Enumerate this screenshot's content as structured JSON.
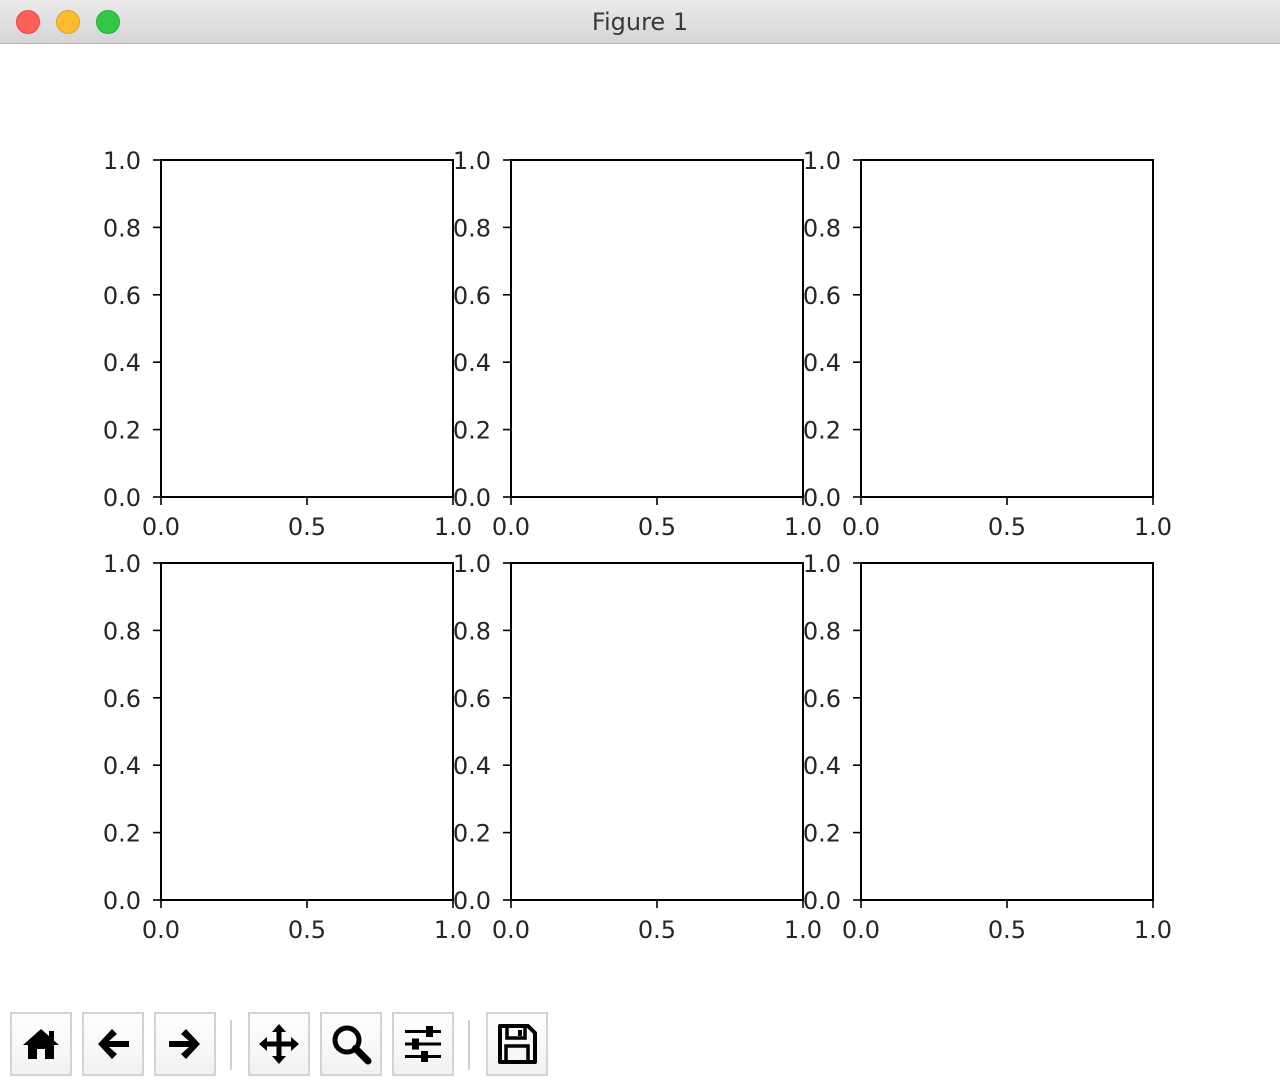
{
  "window": {
    "title": "Figure 1",
    "controls": [
      "close",
      "minimize",
      "zoom"
    ]
  },
  "toolbar": {
    "buttons": [
      {
        "name": "home",
        "icon": "home-icon"
      },
      {
        "name": "back",
        "icon": "arrow-left-icon"
      },
      {
        "name": "forward",
        "icon": "arrow-right-icon"
      },
      {
        "name": "pan",
        "icon": "move-arrows-icon"
      },
      {
        "name": "zoom",
        "icon": "magnifier-icon"
      },
      {
        "name": "configure-subplots",
        "icon": "sliders-icon"
      },
      {
        "name": "save",
        "icon": "floppy-disk-icon"
      }
    ]
  },
  "chart_data": [
    {
      "type": "scatter",
      "series": [],
      "xlim": [
        0,
        1
      ],
      "ylim": [
        0,
        1
      ],
      "xticks": [
        "0.0",
        "0.5",
        "1.0"
      ],
      "yticks": [
        "0.0",
        "0.2",
        "0.4",
        "0.6",
        "0.8",
        "1.0"
      ],
      "grid": false
    },
    {
      "type": "scatter",
      "series": [],
      "xlim": [
        0,
        1
      ],
      "ylim": [
        0,
        1
      ],
      "xticks": [
        "0.0",
        "0.5",
        "1.0"
      ],
      "yticks": [
        "0.0",
        "0.2",
        "0.4",
        "0.6",
        "0.8",
        "1.0"
      ],
      "grid": false
    },
    {
      "type": "scatter",
      "series": [],
      "xlim": [
        0,
        1
      ],
      "ylim": [
        0,
        1
      ],
      "xticks": [
        "0.0",
        "0.5",
        "1.0"
      ],
      "yticks": [
        "0.0",
        "0.2",
        "0.4",
        "0.6",
        "0.8",
        "1.0"
      ],
      "grid": false
    },
    {
      "type": "scatter",
      "series": [],
      "xlim": [
        0,
        1
      ],
      "ylim": [
        0,
        1
      ],
      "xticks": [
        "0.0",
        "0.5",
        "1.0"
      ],
      "yticks": [
        "0.0",
        "0.2",
        "0.4",
        "0.6",
        "0.8",
        "1.0"
      ],
      "grid": false
    },
    {
      "type": "scatter",
      "series": [],
      "xlim": [
        0,
        1
      ],
      "ylim": [
        0,
        1
      ],
      "xticks": [
        "0.0",
        "0.5",
        "1.0"
      ],
      "yticks": [
        "0.0",
        "0.2",
        "0.4",
        "0.6",
        "0.8",
        "1.0"
      ],
      "grid": false
    },
    {
      "type": "scatter",
      "series": [],
      "xlim": [
        0,
        1
      ],
      "ylim": [
        0,
        1
      ],
      "xticks": [
        "0.0",
        "0.5",
        "1.0"
      ],
      "yticks": [
        "0.0",
        "0.2",
        "0.4",
        "0.6",
        "0.8",
        "1.0"
      ],
      "grid": false
    }
  ]
}
